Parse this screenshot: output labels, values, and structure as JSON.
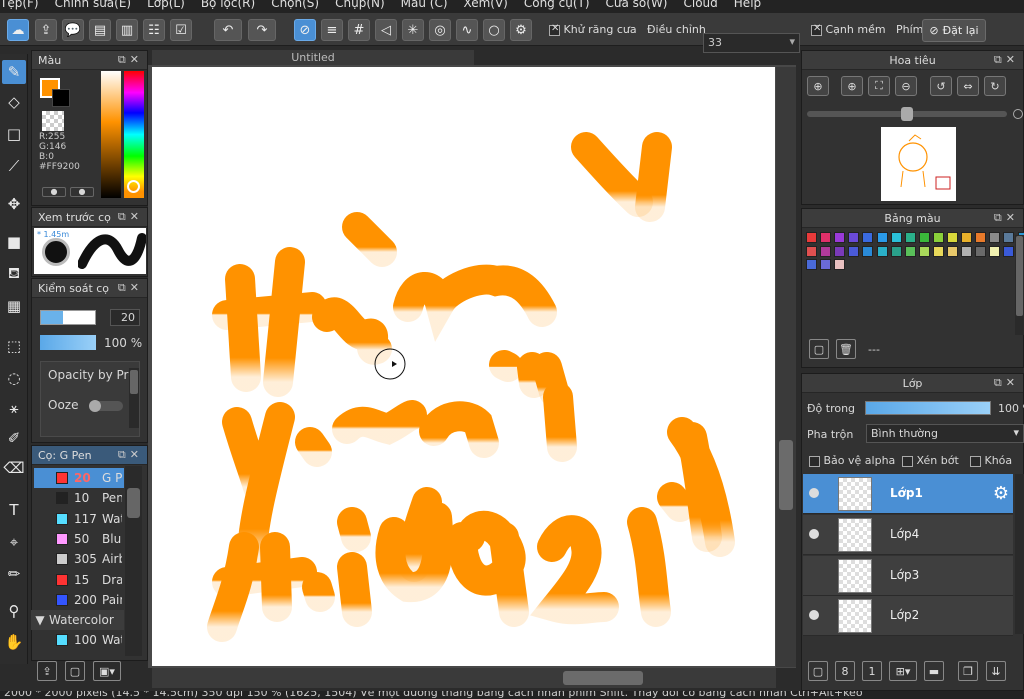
{
  "menu": [
    "Tệp(F)",
    "Chỉnh sửa(E)",
    "Lớp(L)",
    "Bộ lọc(R)",
    "Chọn(S)",
    "Chụp(N)",
    "Màu (C)",
    "Xem(V)",
    "Công cụ(T)",
    "Cửa sổ(W)",
    "Cloud",
    "Help"
  ],
  "toolbar": {
    "antialias_label": "Khử răng cưa",
    "adjust_label": "Điều chỉnh",
    "adjust_value": "33",
    "soft_edge_label": "Cạnh mềm",
    "key_label": "Phím",
    "reset_label": "Đặt lại"
  },
  "color_panel": {
    "title": "Màu",
    "r": "R:255",
    "g": "G:146",
    "b": "B:0",
    "hex": "#FF9200",
    "fg_color": "#FF9200",
    "bg_color": "#000000"
  },
  "brush_preview": {
    "title": "Xem trước cọ",
    "size_label": "* 1.45m"
  },
  "brush_control": {
    "title": "Kiểm soát cọ",
    "size": "20",
    "opacity": "100 %",
    "opacity_by_pressure": "Opacity by Pressure",
    "ooze": "Ooze"
  },
  "brush_list": {
    "title": "Cọ: G Pen",
    "items": [
      {
        "size": "20",
        "name": "G Pen",
        "color": "#ff3333",
        "selected": true
      },
      {
        "size": "10",
        "name": "Pencil",
        "color": "#222222"
      },
      {
        "size": "117",
        "name": "Watercolor",
        "color": "#55ddff"
      },
      {
        "size": "50",
        "name": "Blur",
        "color": "#ff99ff"
      },
      {
        "size": "305",
        "name": "Airbrush",
        "color": "#cccccc"
      },
      {
        "size": "15",
        "name": "Drawing",
        "color": "#ff3333"
      },
      {
        "size": "200",
        "name": "Paint",
        "color": "#3355ff"
      }
    ],
    "group": "Watercolor",
    "group_item": {
      "size": "100",
      "name": "Watercolor",
      "color": "#55ddff"
    }
  },
  "canvas": {
    "tab": "Untitled"
  },
  "navigator": {
    "title": "Hoa tiêu"
  },
  "palette": {
    "title": "Bảng màu",
    "footer": "---",
    "colors": [
      "#e83a3a",
      "#e0306a",
      "#9a3ad8",
      "#6a4ad8",
      "#3a6ae0",
      "#2a9ae8",
      "#2ac0d8",
      "#2ab08a",
      "#3ab83a",
      "#8ad03a",
      "#d8d83a",
      "#e8b02a",
      "#e87a2a",
      "#8a8a8a",
      "#5a7a9a",
      "#2a9ad8",
      "#e8e8e8",
      "#e05050",
      "#b03a9a",
      "#7a3ab8",
      "#4a5ad8",
      "#2a8ad8",
      "#2ab0c8",
      "#2aa08a",
      "#5ac05a",
      "#a8d85a",
      "#e8d85a",
      "#e8c86a",
      "#b0b0b0",
      "#6a6a6a",
      "#f0f0b0",
      "#3a5ad8",
      "#c03a6a",
      "#8a1a1a",
      "#4a6ad8",
      "#6a6ad8",
      "#e8c0c0"
    ]
  },
  "layers": {
    "title": "Lớp",
    "opacity_label": "Độ trong",
    "opacity": "100 %",
    "blend_label": "Pha trộn",
    "blend_value": "Bình thường",
    "protect_alpha": "Bảo vệ alpha",
    "clipping": "Xén bớt",
    "lock": "Khóa",
    "items": [
      {
        "name": "Lớp1",
        "selected": true,
        "visible": true
      },
      {
        "name": "Lớp4",
        "selected": false,
        "visible": true
      },
      {
        "name": "Lớp3",
        "selected": false,
        "visible": false
      },
      {
        "name": "Lớp2",
        "selected": false,
        "visible": true
      }
    ]
  },
  "status": {
    "text": "2000 * 2000 pixels (14.5 * 14.5cm) 350 dpi 150 % (1625, 1504) Vẽ một đường thẳng bằng cách nhấn phím Shift. Thay đổi cỡ bằng cách nhấn Ctrl+Alt+kéo"
  }
}
